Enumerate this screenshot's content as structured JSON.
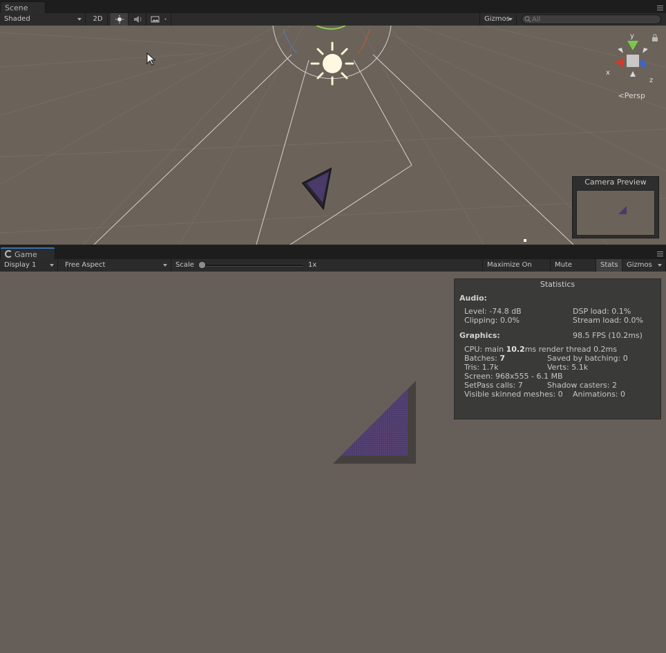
{
  "scene_tab": {
    "label": "Scene"
  },
  "scene_toolbar": {
    "draw_mode": "Shaded",
    "mode_2d": "2D",
    "gizmos": "Gizmos",
    "search_placeholder": "All"
  },
  "scene_view": {
    "axis_labels": {
      "x": "x",
      "y": "y",
      "z": "z"
    },
    "persp_label": "Persp",
    "camera_preview_title": "Camera Preview"
  },
  "game_tab": {
    "label": "Game"
  },
  "game_toolbar": {
    "display": "Display 1",
    "aspect": "Free Aspect",
    "scale_label": "Scale",
    "scale_value": "1x",
    "maximize_on_play": "Maximize On Play",
    "mute_audio": "Mute Audio",
    "stats": "Stats",
    "gizmos": "Gizmos"
  },
  "statistics": {
    "title": "Statistics",
    "audio_header": "Audio:",
    "level": "Level: -74.8 dB",
    "dsp_load": "DSP load: 0.1%",
    "clipping": "Clipping: 0.0%",
    "stream_load": "Stream load: 0.0%",
    "graphics_header": "Graphics:",
    "fps": "98.5 FPS (10.2ms)",
    "cpu_prefix": "CPU: main ",
    "cpu_main_value": "10.2",
    "cpu_suffix": "ms  render thread 0.2ms",
    "batches_prefix": "Batches: ",
    "batches_value": "7",
    "saved_by_batching": "Saved by batching: 0",
    "tris": "Tris: 1.7k",
    "verts": "Verts: 5.1k",
    "screen": "Screen: 968x555 - 6.1 MB",
    "setpass_calls": "SetPass calls: 7",
    "shadow_casters": "Shadow casters: 2",
    "visible_skinned_meshes": "Visible skinned meshes: 0",
    "animations": "Animations: 0"
  },
  "colors": {
    "scene_bg": "#6b6259",
    "game_bg": "#665e58",
    "tab_accent": "#3a72b0",
    "triangle": "#4a3a6a"
  }
}
